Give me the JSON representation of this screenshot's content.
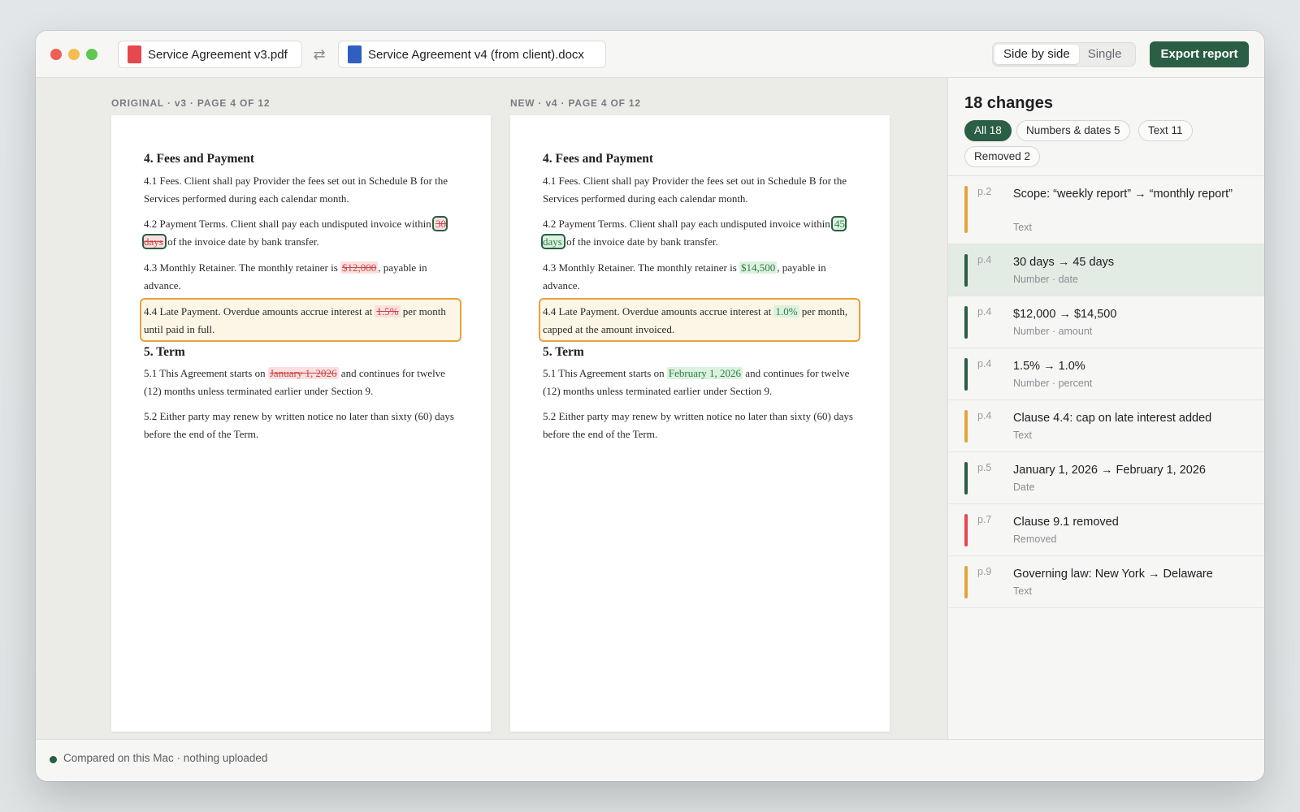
{
  "window": {
    "files": {
      "original": {
        "name": "Service Agreement v3.pdf",
        "icon": "pdf-file-icon",
        "color": "#e5484d"
      },
      "new": {
        "name": "Service Agreement v4 (from client).docx",
        "icon": "docx-file-icon",
        "color": "#2f5fbf"
      },
      "swap_icon": "⇄"
    },
    "view_modes": [
      "Side by side",
      "Single"
    ],
    "active_view_mode": "Side by side",
    "export_label": "Export report",
    "accent_color": "#2a5e45"
  },
  "original": {
    "caption": "ORIGINAL · v3 · PAGE 4 OF 12",
    "h4": "4. Fees and Payment",
    "p41": "4.1 Fees. Client shall pay Provider the fees set out in Schedule B for the Services performed during each calendar month.",
    "p42_pre": "4.2 Payment Terms. Client shall pay each undisputed invoice within ",
    "p42_change": "30 days",
    "p42_post": " of the invoice date by bank transfer.",
    "p43_pre": "4.3 Monthly Retainer. The monthly retainer is ",
    "p43_change": "$12,000",
    "p43_post": ", payable in advance.",
    "p44_pre": "4.4 Late Payment. Overdue amounts accrue interest at ",
    "p44_change": "1.5%",
    "p44_post": " per month until paid in full.",
    "h5": "5. Term",
    "p51_pre": "5.1 This Agreement starts on ",
    "p51_change": "January 1, 2026",
    "p51_post": " and continues for twelve (12) months unless terminated earlier under Section 9.",
    "p52": "5.2 Either party may renew by written notice no later than sixty (60) days before the end of the Term."
  },
  "revised": {
    "caption": "NEW · v4 · PAGE 4 OF 12",
    "h4": "4. Fees and Payment",
    "p41": "4.1 Fees. Client shall pay Provider the fees set out in Schedule B for the Services performed during each calendar month.",
    "p42_pre": "4.2 Payment Terms. Client shall pay each undisputed invoice within ",
    "p42_change": "45 days",
    "p42_post": " of the invoice date by bank transfer.",
    "p43_pre": "4.3 Monthly Retainer. The monthly retainer is ",
    "p43_change": "$14,500",
    "p43_post": ", payable in advance.",
    "p44_pre": "4.4 Late Payment. Overdue amounts accrue interest at ",
    "p44_change": "1.0%",
    "p44_post": " per month, capped at the amount invoiced.",
    "h5": "5. Term",
    "p51_pre": "5.1 This Agreement starts on ",
    "p51_change": "February 1, 2026",
    "p51_post": " and continues for twelve (12) months unless terminated earlier under Section 9.",
    "p52": "5.2 Either party may renew by written notice no later than sixty (60) days before the end of the Term."
  },
  "sidebar": {
    "title": "18 changes",
    "filters": [
      {
        "label": "All 18",
        "active": true
      },
      {
        "label": "Numbers & dates 5",
        "active": false
      },
      {
        "label": "Text 11",
        "active": false
      },
      {
        "label": "Removed 2",
        "active": false
      }
    ],
    "changes": [
      {
        "page": "p.2",
        "title": "Scope: “weekly report” → “monthly report”",
        "type": "Text",
        "color": "#e2a53c",
        "selected": false
      },
      {
        "page": "p.4",
        "title": "30 days → 45 days",
        "type": "Number · date",
        "color": "#2a5e45",
        "selected": true
      },
      {
        "page": "p.4",
        "title": "$12,000 → $14,500",
        "type": "Number · amount",
        "color": "#2a5e45",
        "selected": false
      },
      {
        "page": "p.4",
        "title": "1.5% → 1.0%",
        "type": "Number · percent",
        "color": "#2a5e45",
        "selected": false
      },
      {
        "page": "p.4",
        "title": "Clause 4.4: cap on late interest added",
        "type": "Text",
        "color": "#e2a53c",
        "selected": false
      },
      {
        "page": "p.5",
        "title": "January 1, 2026 → February 1, 2026",
        "type": "Date",
        "color": "#2a5e45",
        "selected": false
      },
      {
        "page": "p.7",
        "title": "Clause 9.1 removed",
        "type": "Removed",
        "color": "#e5484d",
        "selected": false
      },
      {
        "page": "p.9",
        "title": "Governing law: New York → Delaware",
        "type": "Text",
        "color": "#e2a53c",
        "selected": false
      }
    ]
  },
  "status": {
    "text": "Compared on this Mac · nothing uploaded"
  }
}
